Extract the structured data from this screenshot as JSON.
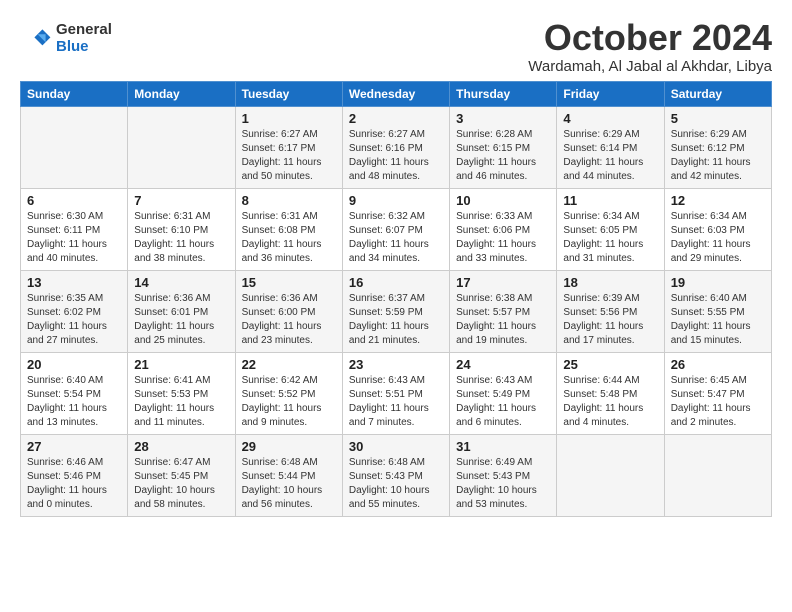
{
  "logo": {
    "general": "General",
    "blue": "Blue"
  },
  "title": "October 2024",
  "subtitle": "Wardamah, Al Jabal al Akhdar, Libya",
  "headers": [
    "Sunday",
    "Monday",
    "Tuesday",
    "Wednesday",
    "Thursday",
    "Friday",
    "Saturday"
  ],
  "weeks": [
    [
      {
        "day": "",
        "sunrise": "",
        "sunset": "",
        "daylight": ""
      },
      {
        "day": "",
        "sunrise": "",
        "sunset": "",
        "daylight": ""
      },
      {
        "day": "1",
        "sunrise": "Sunrise: 6:27 AM",
        "sunset": "Sunset: 6:17 PM",
        "daylight": "Daylight: 11 hours and 50 minutes."
      },
      {
        "day": "2",
        "sunrise": "Sunrise: 6:27 AM",
        "sunset": "Sunset: 6:16 PM",
        "daylight": "Daylight: 11 hours and 48 minutes."
      },
      {
        "day": "3",
        "sunrise": "Sunrise: 6:28 AM",
        "sunset": "Sunset: 6:15 PM",
        "daylight": "Daylight: 11 hours and 46 minutes."
      },
      {
        "day": "4",
        "sunrise": "Sunrise: 6:29 AM",
        "sunset": "Sunset: 6:14 PM",
        "daylight": "Daylight: 11 hours and 44 minutes."
      },
      {
        "day": "5",
        "sunrise": "Sunrise: 6:29 AM",
        "sunset": "Sunset: 6:12 PM",
        "daylight": "Daylight: 11 hours and 42 minutes."
      }
    ],
    [
      {
        "day": "6",
        "sunrise": "Sunrise: 6:30 AM",
        "sunset": "Sunset: 6:11 PM",
        "daylight": "Daylight: 11 hours and 40 minutes."
      },
      {
        "day": "7",
        "sunrise": "Sunrise: 6:31 AM",
        "sunset": "Sunset: 6:10 PM",
        "daylight": "Daylight: 11 hours and 38 minutes."
      },
      {
        "day": "8",
        "sunrise": "Sunrise: 6:31 AM",
        "sunset": "Sunset: 6:08 PM",
        "daylight": "Daylight: 11 hours and 36 minutes."
      },
      {
        "day": "9",
        "sunrise": "Sunrise: 6:32 AM",
        "sunset": "Sunset: 6:07 PM",
        "daylight": "Daylight: 11 hours and 34 minutes."
      },
      {
        "day": "10",
        "sunrise": "Sunrise: 6:33 AM",
        "sunset": "Sunset: 6:06 PM",
        "daylight": "Daylight: 11 hours and 33 minutes."
      },
      {
        "day": "11",
        "sunrise": "Sunrise: 6:34 AM",
        "sunset": "Sunset: 6:05 PM",
        "daylight": "Daylight: 11 hours and 31 minutes."
      },
      {
        "day": "12",
        "sunrise": "Sunrise: 6:34 AM",
        "sunset": "Sunset: 6:03 PM",
        "daylight": "Daylight: 11 hours and 29 minutes."
      }
    ],
    [
      {
        "day": "13",
        "sunrise": "Sunrise: 6:35 AM",
        "sunset": "Sunset: 6:02 PM",
        "daylight": "Daylight: 11 hours and 27 minutes."
      },
      {
        "day": "14",
        "sunrise": "Sunrise: 6:36 AM",
        "sunset": "Sunset: 6:01 PM",
        "daylight": "Daylight: 11 hours and 25 minutes."
      },
      {
        "day": "15",
        "sunrise": "Sunrise: 6:36 AM",
        "sunset": "Sunset: 6:00 PM",
        "daylight": "Daylight: 11 hours and 23 minutes."
      },
      {
        "day": "16",
        "sunrise": "Sunrise: 6:37 AM",
        "sunset": "Sunset: 5:59 PM",
        "daylight": "Daylight: 11 hours and 21 minutes."
      },
      {
        "day": "17",
        "sunrise": "Sunrise: 6:38 AM",
        "sunset": "Sunset: 5:57 PM",
        "daylight": "Daylight: 11 hours and 19 minutes."
      },
      {
        "day": "18",
        "sunrise": "Sunrise: 6:39 AM",
        "sunset": "Sunset: 5:56 PM",
        "daylight": "Daylight: 11 hours and 17 minutes."
      },
      {
        "day": "19",
        "sunrise": "Sunrise: 6:40 AM",
        "sunset": "Sunset: 5:55 PM",
        "daylight": "Daylight: 11 hours and 15 minutes."
      }
    ],
    [
      {
        "day": "20",
        "sunrise": "Sunrise: 6:40 AM",
        "sunset": "Sunset: 5:54 PM",
        "daylight": "Daylight: 11 hours and 13 minutes."
      },
      {
        "day": "21",
        "sunrise": "Sunrise: 6:41 AM",
        "sunset": "Sunset: 5:53 PM",
        "daylight": "Daylight: 11 hours and 11 minutes."
      },
      {
        "day": "22",
        "sunrise": "Sunrise: 6:42 AM",
        "sunset": "Sunset: 5:52 PM",
        "daylight": "Daylight: 11 hours and 9 minutes."
      },
      {
        "day": "23",
        "sunrise": "Sunrise: 6:43 AM",
        "sunset": "Sunset: 5:51 PM",
        "daylight": "Daylight: 11 hours and 7 minutes."
      },
      {
        "day": "24",
        "sunrise": "Sunrise: 6:43 AM",
        "sunset": "Sunset: 5:49 PM",
        "daylight": "Daylight: 11 hours and 6 minutes."
      },
      {
        "day": "25",
        "sunrise": "Sunrise: 6:44 AM",
        "sunset": "Sunset: 5:48 PM",
        "daylight": "Daylight: 11 hours and 4 minutes."
      },
      {
        "day": "26",
        "sunrise": "Sunrise: 6:45 AM",
        "sunset": "Sunset: 5:47 PM",
        "daylight": "Daylight: 11 hours and 2 minutes."
      }
    ],
    [
      {
        "day": "27",
        "sunrise": "Sunrise: 6:46 AM",
        "sunset": "Sunset: 5:46 PM",
        "daylight": "Daylight: 11 hours and 0 minutes."
      },
      {
        "day": "28",
        "sunrise": "Sunrise: 6:47 AM",
        "sunset": "Sunset: 5:45 PM",
        "daylight": "Daylight: 10 hours and 58 minutes."
      },
      {
        "day": "29",
        "sunrise": "Sunrise: 6:48 AM",
        "sunset": "Sunset: 5:44 PM",
        "daylight": "Daylight: 10 hours and 56 minutes."
      },
      {
        "day": "30",
        "sunrise": "Sunrise: 6:48 AM",
        "sunset": "Sunset: 5:43 PM",
        "daylight": "Daylight: 10 hours and 55 minutes."
      },
      {
        "day": "31",
        "sunrise": "Sunrise: 6:49 AM",
        "sunset": "Sunset: 5:43 PM",
        "daylight": "Daylight: 10 hours and 53 minutes."
      },
      {
        "day": "",
        "sunrise": "",
        "sunset": "",
        "daylight": ""
      },
      {
        "day": "",
        "sunrise": "",
        "sunset": "",
        "daylight": ""
      }
    ]
  ]
}
